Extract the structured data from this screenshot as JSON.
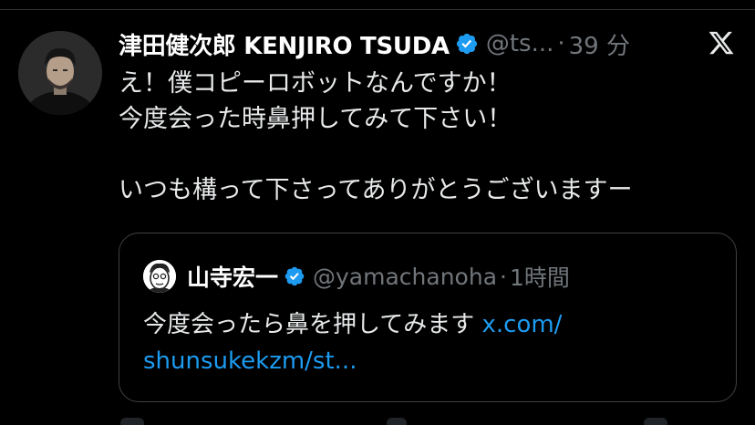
{
  "tweet": {
    "display_name": "津田健次郎 KENJIRO TSUDA",
    "handle": "@ts...",
    "separator": "·",
    "time": "39 分",
    "text_lines": [
      "え！僕コピーロボットなんですか！",
      "今度会った時鼻押してみて下さい！",
      "",
      "いつも構って下さってありがとうございますー"
    ]
  },
  "quote": {
    "display_name": "山寺宏一",
    "handle": "@yamachanoha",
    "separator": "·",
    "time": "1時間",
    "text": "今度会ったら鼻を押してみます ",
    "link_part1": "x.com/",
    "link_part2": "shunsukekzm/st..."
  },
  "icons": {
    "verified": "verified-badge-icon",
    "x_logo": "x-logo-icon"
  },
  "colors": {
    "background": "#000000",
    "text": "#e7e9ea",
    "muted": "#71767b",
    "link": "#1d9bf0",
    "verified": "#1d9bf0"
  }
}
